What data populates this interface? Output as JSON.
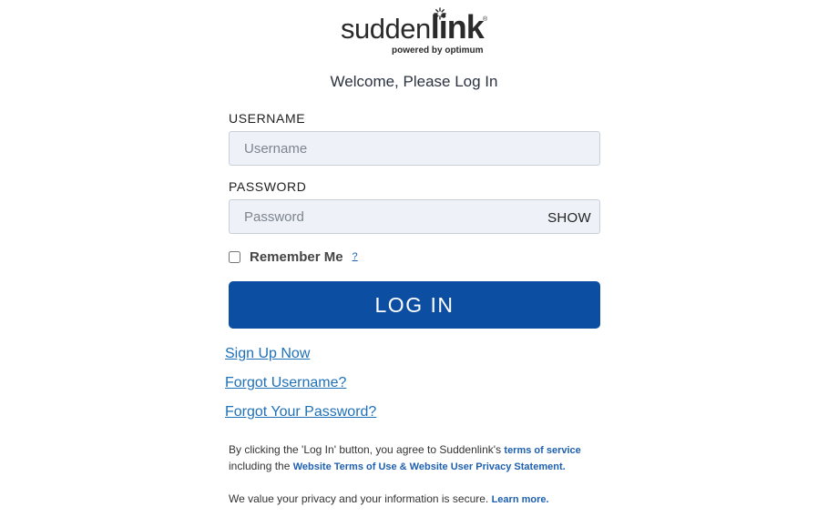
{
  "brand": {
    "wordmark_light": "sudden",
    "wordmark_bold": "link",
    "registered": "®",
    "tagline": "powered by optimum",
    "logo_icon": "sunburst-icon"
  },
  "welcome": "Welcome, Please Log In",
  "username": {
    "label": "USERNAME",
    "placeholder": "Username",
    "value": ""
  },
  "password": {
    "label": "PASSWORD",
    "placeholder": "Password",
    "value": "",
    "show_label": "SHOW"
  },
  "remember": {
    "label": "Remember Me",
    "checked": false,
    "help": "?"
  },
  "login_button": "LOG IN",
  "links": {
    "sign_up": "Sign Up Now",
    "forgot_username": "Forgot Username?",
    "forgot_password": "Forgot Your Password?"
  },
  "legal": {
    "line1_text": "By clicking the 'Log In' button, you agree to Suddenlink's ",
    "terms_link": "terms of service",
    "line2_text": "including the ",
    "privacy_link": "Website Terms of Use & Website User Privacy Statement.",
    "secure_text": "We value your privacy and your information is secure. ",
    "learn_more": "Learn more."
  },
  "colors": {
    "primary_button": "#0c4ea2",
    "link": "#1e70b8",
    "input_bg": "#eef1f7"
  }
}
